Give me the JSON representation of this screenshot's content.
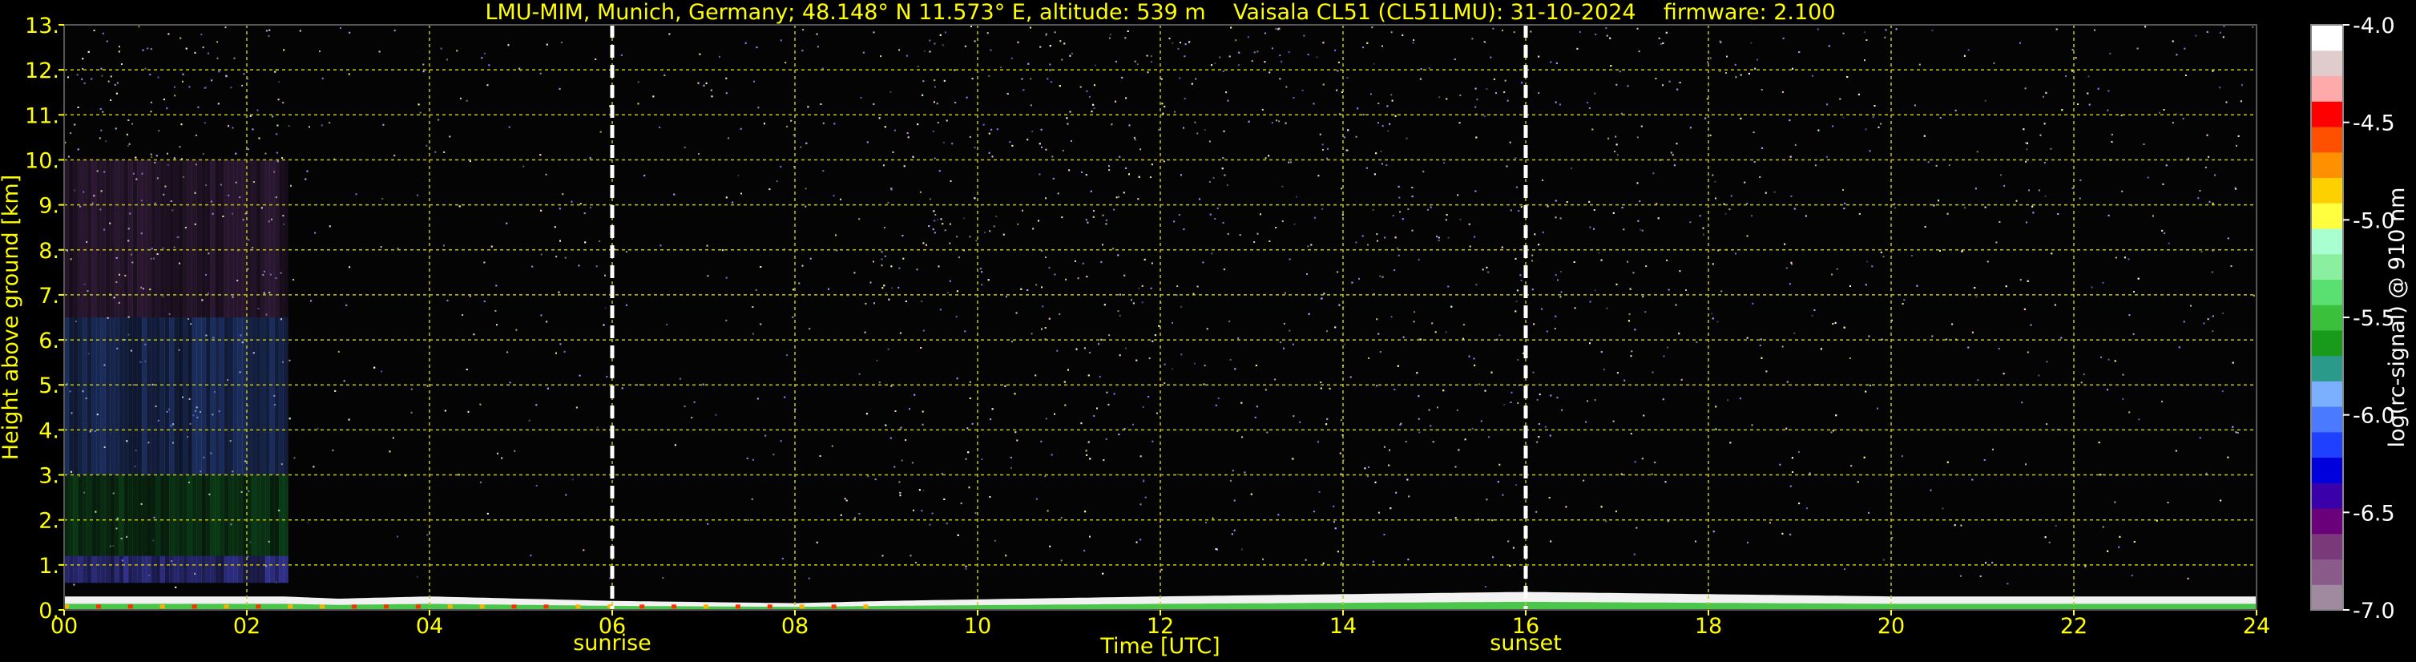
{
  "chart_data": {
    "type": "heatmap",
    "title": "LMU-MIM, Munich, Germany; 48.148° N 11.573° E, altitude: 539 m    Vaisala CL51 (CL51LMU): 31-10-2024    firmware: 2.100",
    "xlabel": "Time [UTC]",
    "ylabel": "Height above ground [km]",
    "colorbar_label": "log(rc-signal) @ 910 nm",
    "xlim": [
      0,
      24
    ],
    "ylim": [
      0,
      13
    ],
    "x_ticks": [
      "00",
      "02",
      "04",
      "06",
      "08",
      "10",
      "12",
      "14",
      "16",
      "18",
      "20",
      "22",
      "24"
    ],
    "y_ticks": [
      "0.",
      "1.",
      "2.",
      "3.",
      "4.",
      "5.",
      "6.",
      "7.",
      "8.",
      "9.",
      "10.",
      "11.",
      "12.",
      "13."
    ],
    "colorbar_range": [
      -7.0,
      -4.0
    ],
    "colorbar_ticks": [
      "-4.0",
      "-4.5",
      "-5.0",
      "-5.5",
      "-6.0",
      "-6.5",
      "-7.0"
    ],
    "grid": true,
    "colors": {
      "background": "#000000",
      "text": "#ffff00",
      "grid": "#c8c800",
      "event_line": "#ffffff"
    },
    "colorscale": [
      "#a08aa0",
      "#8a5a8a",
      "#7a3a7a",
      "#6a007a",
      "#3a00aa",
      "#0000dd",
      "#2040ff",
      "#4a7aff",
      "#7ab0ff",
      "#2a9a8a",
      "#1a9a1a",
      "#3ac03a",
      "#5ae070",
      "#8af0a0",
      "#aaffd0",
      "#ffff40",
      "#ffd000",
      "#ff9000",
      "#ff5000",
      "#ff0000",
      "#ffaaaa",
      "#e0cccc",
      "#ffffff"
    ],
    "events": [
      {
        "label": "sunrise",
        "x": 6.0
      },
      {
        "label": "sunset",
        "x": 16.0
      }
    ],
    "ground_layer_top_km": [
      {
        "x": 0.0,
        "y": 0.3
      },
      {
        "x": 2.4,
        "y": 0.3
      },
      {
        "x": 3.0,
        "y": 0.25
      },
      {
        "x": 4.0,
        "y": 0.3
      },
      {
        "x": 6.0,
        "y": 0.2
      },
      {
        "x": 8.0,
        "y": 0.15
      },
      {
        "x": 9.0,
        "y": 0.2
      },
      {
        "x": 12.0,
        "y": 0.3
      },
      {
        "x": 14.0,
        "y": 0.35
      },
      {
        "x": 16.0,
        "y": 0.4
      },
      {
        "x": 18.0,
        "y": 0.35
      },
      {
        "x": 20.0,
        "y": 0.3
      },
      {
        "x": 22.0,
        "y": 0.3
      },
      {
        "x": 24.0,
        "y": 0.3
      }
    ]
  }
}
